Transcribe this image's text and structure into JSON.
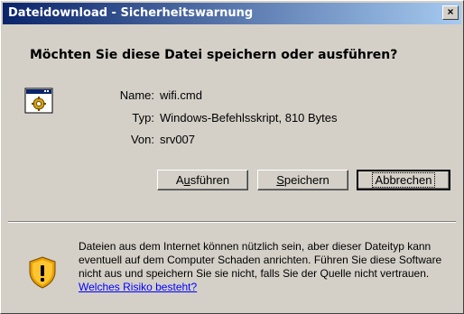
{
  "window": {
    "title": "Dateidownload - Sicherheitswarnung",
    "close_glyph": "×"
  },
  "question": "Möchten Sie diese Datei speichern oder ausführen?",
  "file": {
    "icon": "batch-file-icon",
    "name_label": "Name:",
    "name_value": "wifi.cmd",
    "type_label": "Typ:",
    "type_value": "Windows-Befehlsskript, 810 Bytes",
    "from_label": "Von:",
    "from_value": "srv007"
  },
  "buttons": {
    "run_pre": "A",
    "run_accel": "u",
    "run_post": "sführen",
    "save_accel": "S",
    "save_post": "peichern",
    "cancel": "Abbrechen"
  },
  "warning": {
    "icon": "security-shield-icon",
    "text": "Dateien aus dem Internet können nützlich sein, aber dieser Dateityp kann eventuell auf dem Computer Schaden anrichten. Führen Sie diese Software nicht aus und speichern Sie sie nicht, falls Sie der Quelle nicht vertrauen. ",
    "link": "Welches Risiko besteht?"
  },
  "colors": {
    "titlebar_start": "#0a246a",
    "titlebar_end": "#a6caf0",
    "face": "#d4d0c8",
    "link": "#0000ff"
  }
}
